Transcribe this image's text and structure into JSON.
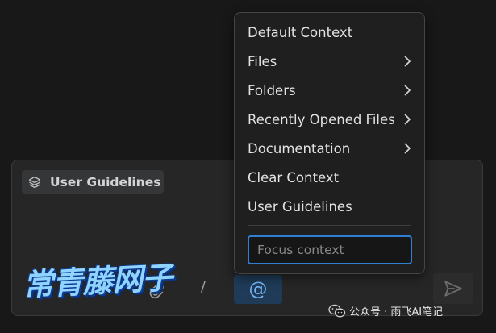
{
  "menu": {
    "items": [
      {
        "label": "Default Context",
        "has_submenu": false
      },
      {
        "label": "Files",
        "has_submenu": true
      },
      {
        "label": "Folders",
        "has_submenu": true
      },
      {
        "label": "Recently Opened Files",
        "has_submenu": true
      },
      {
        "label": "Documentation",
        "has_submenu": true
      },
      {
        "label": "Clear Context",
        "has_submenu": false
      },
      {
        "label": "User Guidelines",
        "has_submenu": false
      }
    ],
    "search": {
      "placeholder": "Focus context",
      "value": ""
    }
  },
  "chat": {
    "context_chip": {
      "label": "User Guidelines",
      "icon": "layers-icon"
    },
    "toolbar": {
      "attach_icon": "paperclip-icon",
      "slash_label": "/",
      "mention_label": "@",
      "send_icon": "send-icon"
    }
  },
  "watermark": {
    "overlay_text": "常青藤网子",
    "wechat_label": "公众号 · 雨飞AI笔记"
  },
  "colors": {
    "accent": "#2f80d1",
    "mention_bg": "#1f3b58",
    "mention_fg": "#75b7f7"
  }
}
